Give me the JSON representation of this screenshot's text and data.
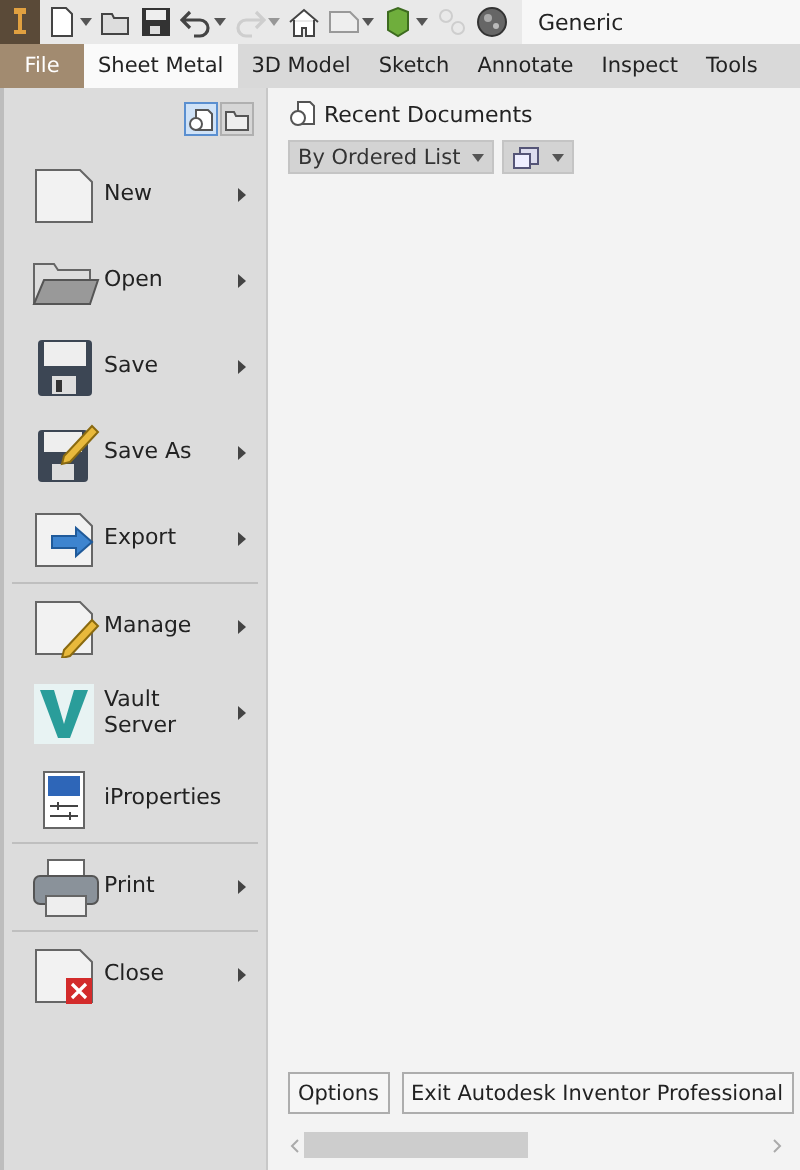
{
  "toolbar": {
    "items": [
      {
        "kind": "new",
        "disabled": false,
        "caret": true
      },
      {
        "kind": "open",
        "disabled": false,
        "caret": false
      },
      {
        "kind": "save",
        "disabled": false,
        "caret": false
      },
      {
        "kind": "undo",
        "disabled": false,
        "caret": true
      },
      {
        "kind": "redo",
        "disabled": true,
        "caret": true
      },
      {
        "kind": "home",
        "disabled": false,
        "caret": false
      },
      {
        "kind": "doc",
        "disabled": false,
        "caret": true
      },
      {
        "kind": "cube",
        "disabled": false,
        "caret": true
      },
      {
        "kind": "link",
        "disabled": true,
        "caret": false
      },
      {
        "kind": "globe",
        "disabled": false,
        "caret": false
      }
    ],
    "appearance_field": "Generic"
  },
  "tabs": [
    {
      "label": "File",
      "selected": false,
      "kind": "file"
    },
    {
      "label": "Sheet Metal",
      "selected": true,
      "kind": "tab"
    },
    {
      "label": "3D Model",
      "selected": false,
      "kind": "tab"
    },
    {
      "label": "Sketch",
      "selected": false,
      "kind": "tab"
    },
    {
      "label": "Annotate",
      "selected": false,
      "kind": "tab"
    },
    {
      "label": "Inspect",
      "selected": false,
      "kind": "tab"
    },
    {
      "label": "Tools",
      "selected": false,
      "kind": "tab"
    }
  ],
  "view_toggles": [
    {
      "kind": "recent",
      "selected": true
    },
    {
      "kind": "open",
      "selected": false
    }
  ],
  "menu": [
    {
      "label": "New",
      "kind": "new",
      "submenu": true,
      "separator_after": false
    },
    {
      "label": "Open",
      "kind": "open",
      "submenu": true,
      "separator_after": false
    },
    {
      "label": "Save",
      "kind": "save",
      "submenu": true,
      "separator_after": false
    },
    {
      "label": "Save As",
      "kind": "save_as",
      "submenu": true,
      "separator_after": false
    },
    {
      "label": "Export",
      "kind": "export",
      "submenu": true,
      "separator_after": true
    },
    {
      "label": "Manage",
      "kind": "manage",
      "submenu": true,
      "separator_after": false
    },
    {
      "label": "Vault\nServer",
      "kind": "vault",
      "submenu": true,
      "separator_after": false
    },
    {
      "label": "iProperties",
      "kind": "iproperties",
      "submenu": false,
      "separator_after": true
    },
    {
      "label": "Print",
      "kind": "print",
      "submenu": true,
      "separator_after": true
    },
    {
      "label": "Close",
      "kind": "close",
      "submenu": true,
      "separator_after": false
    }
  ],
  "recent": {
    "title": "Recent Documents",
    "sort": "By Ordered List"
  },
  "footer_buttons": [
    "Options",
    "Exit Autodesk Inventor Professional"
  ]
}
